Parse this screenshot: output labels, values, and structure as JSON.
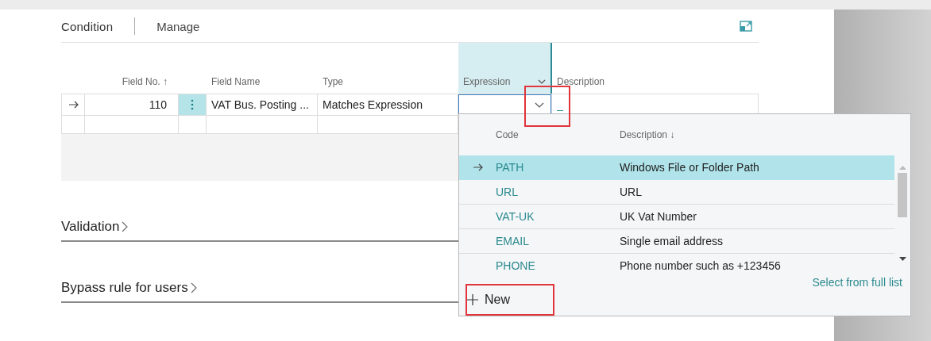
{
  "tabs": [
    {
      "label": "Condition",
      "selected": true
    },
    {
      "label": "Manage",
      "selected": false
    }
  ],
  "lines": {
    "columns": [
      {
        "label": "Field No. ↑"
      },
      {
        "label": "Field Name"
      },
      {
        "label": "Type"
      },
      {
        "label": "Expression",
        "active": true
      },
      {
        "label": "Description"
      }
    ],
    "rows": [
      {
        "current": true,
        "field_no": "110",
        "field_name": "VAT Bus. Posting ...",
        "type": "Matches Expression"
      },
      {
        "current": false
      }
    ]
  },
  "lookup": {
    "columns": [
      {
        "label": "Code"
      },
      {
        "label": "Description ↓"
      }
    ],
    "rows": [
      {
        "code": "PATH",
        "description": "Windows File or Folder Path",
        "selected": true
      },
      {
        "code": "URL",
        "description": "URL",
        "selected": false
      },
      {
        "code": "VAT-UK",
        "description": "UK Vat Number",
        "selected": false
      },
      {
        "code": "EMAIL",
        "description": "Single email address",
        "selected": false
      },
      {
        "code": "PHONE",
        "description": "Phone number such as +123456",
        "selected": false
      }
    ],
    "new_button": {
      "label": "New",
      "highlighted": true
    },
    "full_list_link": "Select from full list"
  },
  "expression_dropdown": {
    "highlighted": true
  },
  "sections": [
    {
      "title": "Validation",
      "expanded": false
    },
    {
      "title": "Bypass rule for users",
      "expanded": false
    }
  ]
}
